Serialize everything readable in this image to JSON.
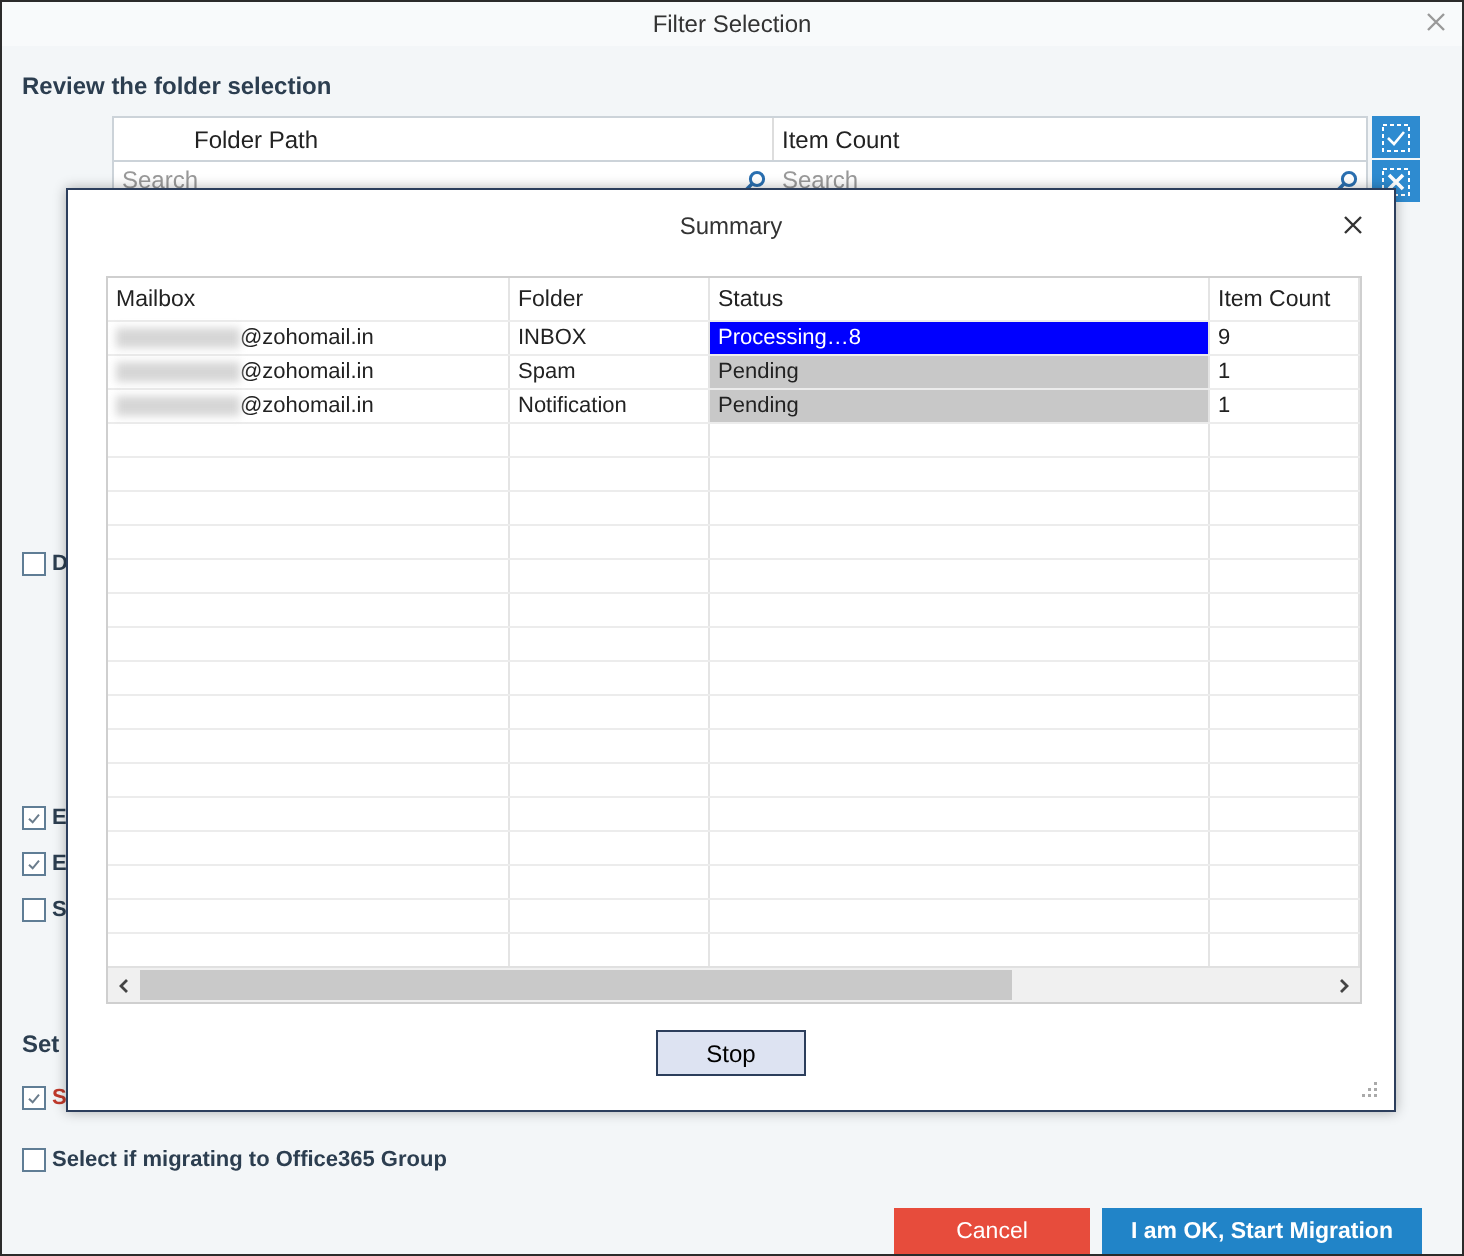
{
  "window": {
    "title": "Filter Selection"
  },
  "heading": "Review the folder selection",
  "folder_grid": {
    "columns": [
      "Folder Path",
      "Item Count"
    ],
    "search_placeholders": [
      "Search",
      "Search"
    ]
  },
  "options": [
    {
      "label": "D",
      "checked": false
    },
    {
      "label": "E",
      "checked": true
    },
    {
      "label": "E",
      "checked": true
    },
    {
      "label": "S",
      "checked": false
    }
  ],
  "settings_heading": "Set",
  "setting_options": [
    {
      "label": "S",
      "checked": true,
      "highlight": true
    },
    {
      "label": "Select if migrating to Office365 Group",
      "checked": false,
      "highlight": false
    }
  ],
  "buttons": [
    "Cancel",
    "I am OK, Start Migration"
  ],
  "summary": {
    "title": "Summary",
    "columns": [
      "Mailbox",
      "Folder",
      "Status",
      "Item Count"
    ],
    "rows": [
      {
        "mailbox": "@zohomail.in",
        "folder": "INBOX",
        "status": "Processing…8",
        "active": true,
        "item_count": "9"
      },
      {
        "mailbox": "@zohomail.in",
        "folder": "Spam",
        "status": "Pending",
        "active": false,
        "item_count": "1"
      },
      {
        "mailbox": "@zohomail.in",
        "folder": "Notification",
        "status": "Pending",
        "active": false,
        "item_count": "1"
      }
    ],
    "stop_button": "Stop"
  }
}
